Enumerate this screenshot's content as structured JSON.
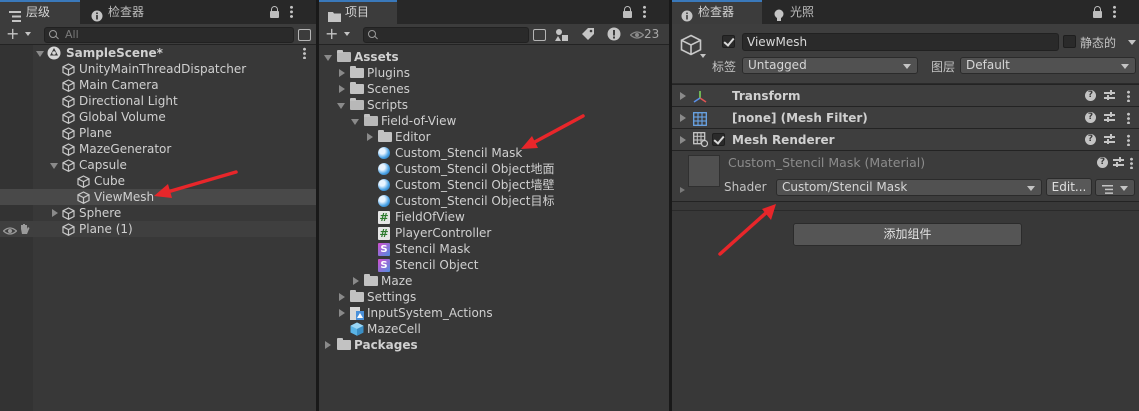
{
  "hierarchy": {
    "tab_label": "层级",
    "other_tab_label": "检查器",
    "search_placeholder": "All",
    "scene_name": "SampleScene*",
    "items": [
      {
        "label": "UnityMainThreadDispatcher"
      },
      {
        "label": "Main Camera"
      },
      {
        "label": "Directional Light"
      },
      {
        "label": "Global Volume"
      },
      {
        "label": "Plane"
      },
      {
        "label": "MazeGenerator"
      },
      {
        "label": "Capsule"
      },
      {
        "label": "Cube"
      },
      {
        "label": "ViewMesh"
      },
      {
        "label": "Sphere"
      },
      {
        "label": "Plane (1)"
      }
    ]
  },
  "project": {
    "tab_label": "项目",
    "hidden_count": "23",
    "items": [
      {
        "label": "Assets"
      },
      {
        "label": "Plugins"
      },
      {
        "label": "Scenes"
      },
      {
        "label": "Scripts"
      },
      {
        "label": "Field-of-View"
      },
      {
        "label": "Editor"
      },
      {
        "label": "Custom_Stencil Mask"
      },
      {
        "label": "Custom_Stencil Object地面"
      },
      {
        "label": "Custom_Stencil Object墙壁"
      },
      {
        "label": "Custom_Stencil Object目标"
      },
      {
        "label": "FieldOfView"
      },
      {
        "label": "PlayerController"
      },
      {
        "label": "Stencil Mask"
      },
      {
        "label": "Stencil Object"
      },
      {
        "label": "Maze"
      },
      {
        "label": "Settings"
      },
      {
        "label": "InputSystem_Actions"
      },
      {
        "label": "MazeCell"
      },
      {
        "label": "Packages"
      }
    ]
  },
  "inspector": {
    "tab_label": "检查器",
    "lighting_tab_label": "光照",
    "object_name": "ViewMesh",
    "static_label": "静态的",
    "tag_label": "标签",
    "tag_value": "Untagged",
    "layer_label": "图层",
    "layer_value": "Default",
    "components": [
      {
        "label": "Transform"
      },
      {
        "label": "[none] (Mesh Filter)"
      },
      {
        "label": "Mesh Renderer"
      }
    ],
    "material": {
      "title": "Custom_Stencil Mask (Material)",
      "shader_label": "Shader",
      "shader_value": "Custom/Stencil Mask",
      "edit_label": "Edit..."
    },
    "add_component_label": "添加组件"
  }
}
